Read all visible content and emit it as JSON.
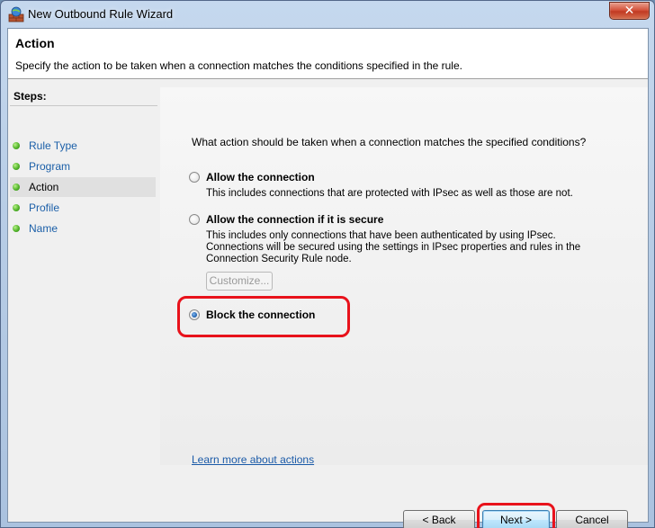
{
  "window": {
    "title": "New Outbound Rule Wizard",
    "close_label": "✕"
  },
  "header": {
    "title": "Action",
    "description": "Specify the action to be taken when a connection matches the conditions specified in the rule."
  },
  "steps": {
    "label": "Steps:",
    "items": [
      {
        "label": "Rule Type"
      },
      {
        "label": "Program"
      },
      {
        "label": "Action"
      },
      {
        "label": "Profile"
      },
      {
        "label": "Name"
      }
    ]
  },
  "main": {
    "question": "What action should be taken when a connection matches the specified conditions?",
    "options": [
      {
        "label": "Allow the connection",
        "description": "This includes connections that are protected with IPsec as well as those are not.",
        "selected": false
      },
      {
        "label": "Allow the connection if it is secure",
        "description": "This includes only connections that have been authenticated by using IPsec.  Connections will be secured using the settings in IPsec properties and rules in the Connection Security Rule node.",
        "selected": false
      },
      {
        "label": "Block the connection",
        "selected": true
      }
    ],
    "customize_label": "Customize...",
    "learn_more": "Learn more about actions"
  },
  "buttons": {
    "back": "< Back",
    "next": "Next >",
    "cancel": "Cancel"
  },
  "colors": {
    "highlight": "#e8121b",
    "link": "#1a5aa8"
  }
}
